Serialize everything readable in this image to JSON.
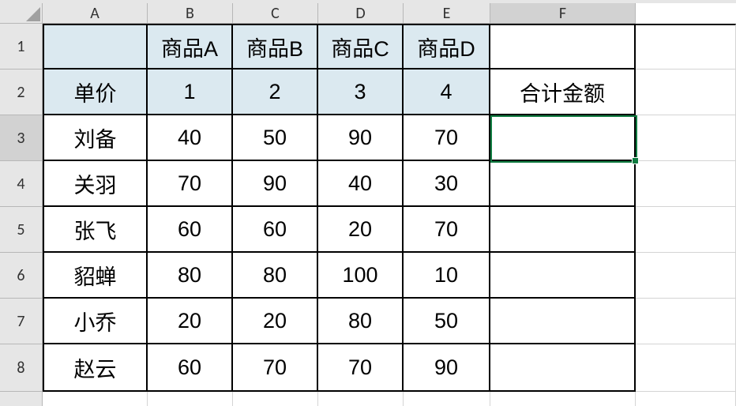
{
  "columns": {
    "A": "A",
    "B": "B",
    "C": "C",
    "D": "D",
    "E": "E",
    "F": "F"
  },
  "rows": {
    "1": "1",
    "2": "2",
    "3": "3",
    "4": "4",
    "5": "5",
    "6": "6",
    "7": "7",
    "8": "8"
  },
  "cells": {
    "A1": "",
    "B1": "商品A",
    "C1": "商品B",
    "D1": "商品C",
    "E1": "商品D",
    "F1": "",
    "A2": "单价",
    "B2": "1",
    "C2": "2",
    "D2": "3",
    "E2": "4",
    "F2": "合计金额",
    "A3": "刘备",
    "B3": "40",
    "C3": "50",
    "D3": "90",
    "E3": "70",
    "F3": "",
    "A4": "关羽",
    "B4": "70",
    "C4": "90",
    "D4": "40",
    "E4": "30",
    "F4": "",
    "A5": "张飞",
    "B5": "60",
    "C5": "60",
    "D5": "20",
    "E5": "70",
    "F5": "",
    "A6": "貂蝉",
    "B6": "80",
    "C6": "80",
    "D6": "100",
    "E6": "10",
    "F6": "",
    "A7": "小乔",
    "B7": "20",
    "C7": "20",
    "D7": "80",
    "E7": "50",
    "F7": "",
    "A8": "赵云",
    "B8": "60",
    "C8": "70",
    "D8": "70",
    "E8": "90",
    "F8": ""
  },
  "selection": {
    "active_cell": "F3"
  },
  "chart_data": {
    "type": "table",
    "title": "",
    "columns": [
      "",
      "商品A",
      "商品B",
      "商品C",
      "商品D",
      "合计金额"
    ],
    "price_row_label": "单价",
    "prices": [
      1,
      2,
      3,
      4
    ],
    "rows": [
      {
        "name": "刘备",
        "values": [
          40,
          50,
          90,
          70
        ]
      },
      {
        "name": "关羽",
        "values": [
          70,
          90,
          40,
          30
        ]
      },
      {
        "name": "张飞",
        "values": [
          60,
          60,
          20,
          70
        ]
      },
      {
        "name": "貂蝉",
        "values": [
          80,
          80,
          100,
          10
        ]
      },
      {
        "name": "小乔",
        "values": [
          20,
          20,
          80,
          50
        ]
      },
      {
        "name": "赵云",
        "values": [
          60,
          70,
          70,
          90
        ]
      }
    ]
  }
}
